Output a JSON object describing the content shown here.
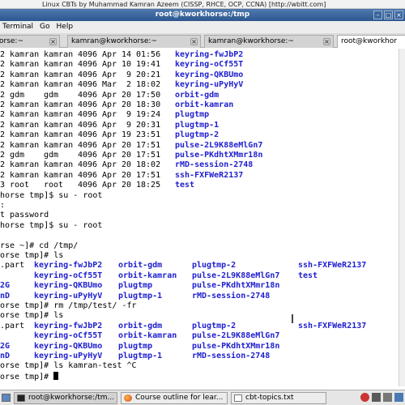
{
  "overlay": {
    "caption": "Linux CBTs by Muhammad Kamran Azeem (CISSP, RHCE, OCP, CCNA) [http://wbitt.com]"
  },
  "window": {
    "title": "root@kworkhorse:/tmp",
    "minimize": "–",
    "maximize": "□",
    "close": "×"
  },
  "menu": {
    "items": [
      "Terminal",
      "Go",
      "Help"
    ]
  },
  "tabs": [
    {
      "label": "orse:~",
      "close": "×"
    },
    {
      "label": "kamran@kworkhorse:~",
      "close": "×"
    },
    {
      "label": "kamran@kworkhorse:~",
      "close": "×"
    },
    {
      "label": "root@kworkhor",
      "close": "×"
    }
  ],
  "terminal": {
    "ls_rows": [
      {
        "links": "2",
        "owner": "kamran",
        "group": "kamran",
        "size": "4096",
        "month": "Apr",
        "day": "14",
        "time": "01:56",
        "name": "keyring-fwJbP2"
      },
      {
        "links": "2",
        "owner": "kamran",
        "group": "kamran",
        "size": "4096",
        "month": "Apr",
        "day": "10",
        "time": "19:41",
        "name": "keyring-oCf55T"
      },
      {
        "links": "2",
        "owner": "kamran",
        "group": "kamran",
        "size": "4096",
        "month": "Apr",
        "day": " 9",
        "time": "20:21",
        "name": "keyring-QKBUmo"
      },
      {
        "links": "2",
        "owner": "kamran",
        "group": "kamran",
        "size": "4096",
        "month": "Mar",
        "day": " 2",
        "time": "18:02",
        "name": "keyring-uPyHyV"
      },
      {
        "links": "2",
        "owner": "gdm",
        "group": "gdm",
        "size": "4096",
        "month": "Apr",
        "day": "20",
        "time": "17:50",
        "name": "orbit-gdm"
      },
      {
        "links": "2",
        "owner": "kamran",
        "group": "kamran",
        "size": "4096",
        "month": "Apr",
        "day": "20",
        "time": "18:30",
        "name": "orbit-kamran"
      },
      {
        "links": "2",
        "owner": "kamran",
        "group": "kamran",
        "size": "4096",
        "month": "Apr",
        "day": " 9",
        "time": "19:24",
        "name": "plugtmp"
      },
      {
        "links": "2",
        "owner": "kamran",
        "group": "kamran",
        "size": "4096",
        "month": "Apr",
        "day": " 9",
        "time": "20:31",
        "name": "plugtmp-1"
      },
      {
        "links": "2",
        "owner": "kamran",
        "group": "kamran",
        "size": "4096",
        "month": "Apr",
        "day": "19",
        "time": "23:51",
        "name": "plugtmp-2"
      },
      {
        "links": "2",
        "owner": "kamran",
        "group": "kamran",
        "size": "4096",
        "month": "Apr",
        "day": "20",
        "time": "17:51",
        "name": "pulse-2L9K88eMlGn7"
      },
      {
        "links": "2",
        "owner": "gdm",
        "group": "gdm",
        "size": "4096",
        "month": "Apr",
        "day": "20",
        "time": "17:51",
        "name": "pulse-PKdhtXMmr18n"
      },
      {
        "links": "2",
        "owner": "kamran",
        "group": "kamran",
        "size": "4096",
        "month": "Apr",
        "day": "20",
        "time": "18:02",
        "name": "rMD-session-2748"
      },
      {
        "links": "2",
        "owner": "kamran",
        "group": "kamran",
        "size": "4096",
        "month": "Apr",
        "day": "20",
        "time": "17:51",
        "name": "ssh-FXFWeR2137"
      },
      {
        "links": "3",
        "owner": "root",
        "group": "root",
        "size": "4096",
        "month": "Apr",
        "day": "20",
        "time": "18:25",
        "name": "test"
      }
    ],
    "line_su1": "horse tmp]$ su - root",
    "line_pw_label": ": ",
    "line_pw_error": "t password",
    "line_su2": "horse tmp]$ su - root",
    "line_cd": "rse ~]# cd /tmp/",
    "line_ls1": "orse tmp]# ls",
    "grid1": [
      [
        ".part",
        "keyring-fwJbP2",
        "orbit-gdm",
        "plugtmp-2",
        "ssh-FXFWeR2137"
      ],
      [
        "",
        "keyring-oCf55T",
        "orbit-kamran",
        "pulse-2L9K88eMlGn7",
        "test"
      ],
      [
        "2G",
        "keyring-QKBUmo",
        "plugtmp",
        "pulse-PKdhtXMmr18n",
        ""
      ],
      [
        "nD",
        "keyring-uPyHyV",
        "plugtmp-1",
        "rMD-session-2748",
        ""
      ]
    ],
    "line_rm": "orse tmp]# rm /tmp/test/ -fr",
    "line_ls2": "orse tmp]# ls",
    "grid2": [
      [
        ".part",
        "keyring-fwJbP2",
        "orbit-gdm",
        "plugtmp-2",
        "ssh-FXFWeR2137"
      ],
      [
        "",
        "keyring-oCf55T",
        "orbit-kamran",
        "pulse-2L9K88eMlGn7",
        ""
      ],
      [
        "2G",
        "keyring-QKBUmo",
        "plugtmp",
        "pulse-PKdhtXMmr18n",
        ""
      ],
      [
        "nD",
        "keyring-uPyHyV",
        "plugtmp-1",
        "rMD-session-2748",
        ""
      ]
    ],
    "line_ls3": "orse tmp]# ls kamran-test ^C",
    "line_prompt": "orse tmp]# "
  },
  "taskbar": {
    "tasks": [
      {
        "label": "root@kworkhorse:/tm...",
        "icon": "terminal-icon"
      },
      {
        "label": "Course outline for lear...",
        "icon": "firefox-icon"
      },
      {
        "label": "cbt-topics.txt",
        "icon": "text-editor-icon"
      }
    ]
  },
  "colors": {
    "dir_blue": "#2020d0",
    "titlebar": "#2c578f"
  }
}
